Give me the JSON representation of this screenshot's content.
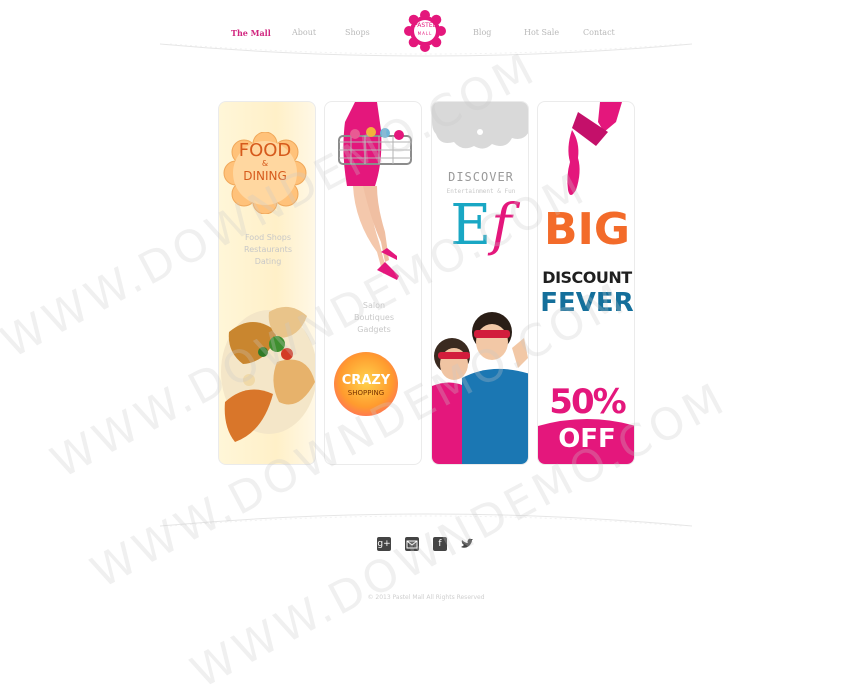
{
  "nav": {
    "items": [
      "The Mall",
      "About",
      "Shops",
      "Blog",
      "Hot Sale",
      "Contact"
    ],
    "logo_line1": "PASTEL",
    "logo_line2": "MALL"
  },
  "panels": {
    "food": {
      "title1": "FOOD",
      "title2": "&",
      "title3": "DINING",
      "lines": [
        "Food Shops",
        "Restaurants",
        "Dating"
      ]
    },
    "shops": {
      "lines": [
        "Salon",
        "Boutiques",
        "Gadgets"
      ],
      "badge1": "CRAZY",
      "badge2": "SHOPPING"
    },
    "entertainment": {
      "heading": "DISCOVER",
      "sub": "Entertainment & Fun",
      "mark_e": "E",
      "mark_f": "f"
    },
    "sale": {
      "big": "BIG",
      "discount": "DISCOUNT",
      "fever": "FEVER",
      "percent": "50%",
      "off": "OFF"
    }
  },
  "footer": {
    "icons": [
      "google-plus-icon",
      "mail-icon",
      "facebook-icon",
      "twitter-icon"
    ],
    "copyright": "© 2013 Pastel Mall All Rights Reserved"
  },
  "watermark": "WWW.DOWNDEMO.COM",
  "colors": {
    "accent_pink": "#e4177c",
    "accent_blue": "#146f9b",
    "accent_orange": "#f36b2a"
  }
}
